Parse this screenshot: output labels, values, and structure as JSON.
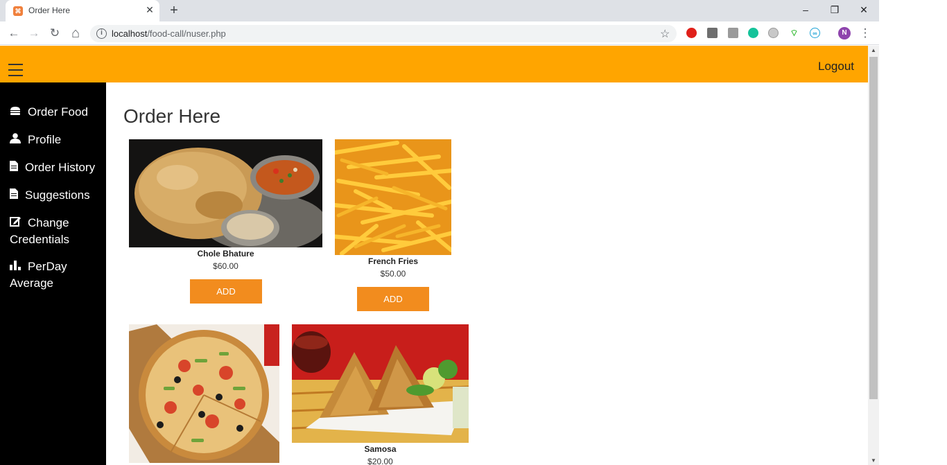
{
  "browser": {
    "tab_title": "Order Here",
    "tab_favicon": "xampp-icon",
    "close_glyph": "✕",
    "new_tab_glyph": "+",
    "url_host": "localhost",
    "url_path": "/food-call/nuser.php",
    "win_minimize": "–",
    "win_restore": "❐",
    "win_close": "✕",
    "back_glyph": "←",
    "forward_glyph": "→",
    "reload_glyph": "↻",
    "home_glyph": "⌂",
    "star_glyph": "☆",
    "profile_initial": "N",
    "menu_glyph": "⋮",
    "info_glyph": "i",
    "extensions": [
      "opera-icon",
      "evernote-icon",
      "tab-icon",
      "grammarly-icon",
      "clipboard-icon",
      "wifi-icon",
      "infinity-icon"
    ]
  },
  "topbar": {
    "logout_label": "Logout",
    "accent": "#ffa500"
  },
  "sidebar": {
    "items": [
      {
        "icon": "burger-icon",
        "glyph": "🍔",
        "label": "Order Food"
      },
      {
        "icon": "user-icon",
        "glyph": "👤",
        "label": "Profile"
      },
      {
        "icon": "file-icon",
        "glyph": "📄",
        "label": "Order History"
      },
      {
        "icon": "file-icon",
        "glyph": "📄",
        "label": "Suggestions"
      },
      {
        "icon": "edit-icon",
        "glyph": "✎",
        "label": "Change Credentials"
      },
      {
        "icon": "bar-chart-icon",
        "glyph": "▟",
        "label": "PerDay Average"
      }
    ]
  },
  "main": {
    "heading": "Order Here",
    "items": [
      {
        "name": "Chole Bhature",
        "price": "$60.00",
        "button": "ADD",
        "image": "chole-bhature-image"
      },
      {
        "name": "French Fries",
        "price": "$50.00",
        "button": "ADD",
        "image": "french-fries-image"
      },
      {
        "name": "",
        "price": "",
        "button": "",
        "image": "pizza-image"
      },
      {
        "name": "Samosa",
        "price": "$20.00",
        "button": "",
        "image": "samosa-image"
      }
    ],
    "button_color": "#f28c1e"
  }
}
